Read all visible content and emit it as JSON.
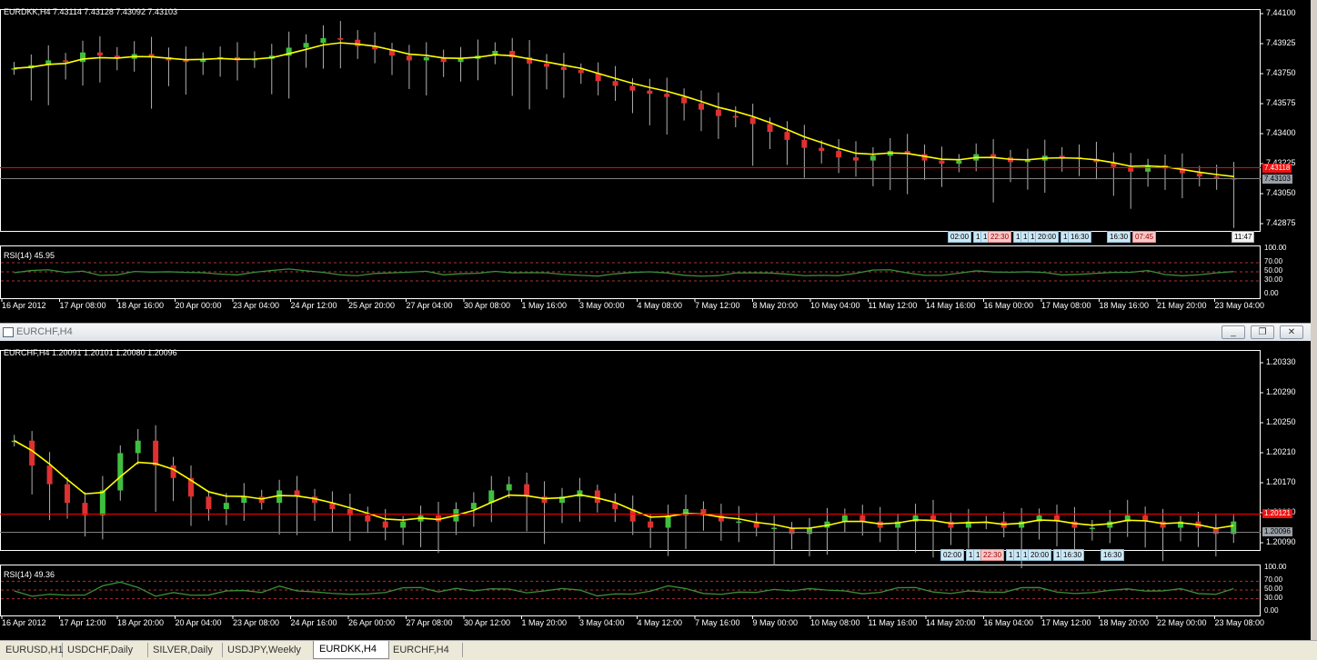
{
  "top_chart": {
    "info": "EURDKK,H4  7.43114 7.43128 7.43092 7.43103",
    "rsi_label": "RSI(14) 45.95",
    "price_ticks": [
      "7.44100",
      "7.43925",
      "7.43750",
      "7.43575",
      "7.43400",
      "7.43225",
      "7.43050",
      "7.42875"
    ],
    "rsi_ticks": [
      "100.00",
      "70.00",
      "50.00",
      "30.00",
      "0.00"
    ],
    "ask_badge": "7.43118",
    "bid_badge": "7.43103",
    "time_labels": [
      "16 Apr 2012",
      "17 Apr 08:00",
      "18 Apr 16:00",
      "20 Apr 00:00",
      "23 Apr 04:00",
      "24 Apr 12:00",
      "25 Apr 20:00",
      "27 Apr 04:00",
      "30 Apr 08:00",
      "1 May 16:00",
      "3 May 00:00",
      "4 May 08:00",
      "7 May 12:00",
      "8 May 20:00",
      "10 May 04:00",
      "11 May 12:00",
      "14 May 16:00",
      "16 May 00:00",
      "17 May 08:00",
      "18 May 16:00",
      "21 May 20:00",
      "23 May 04:00"
    ],
    "event_tags": [
      {
        "text": "02:00",
        "style": "blue"
      },
      {
        "text": "1",
        "style": "blue"
      },
      {
        "text": "1",
        "style": "blue"
      },
      {
        "text": "22:30",
        "style": "red"
      },
      {
        "text": "1",
        "style": "blue"
      },
      {
        "text": "1",
        "style": "blue"
      },
      {
        "text": "1",
        "style": "blue"
      },
      {
        "text": "20:00",
        "style": "blue"
      },
      {
        "text": "1",
        "style": "blue"
      },
      {
        "text": "16:30",
        "style": "blue"
      },
      {
        "text": "16:30",
        "style": "blue"
      },
      {
        "text": "07:45",
        "style": "red"
      },
      {
        "text": "11:47",
        "style": "white"
      }
    ]
  },
  "window": {
    "title": "EURCHF,H4",
    "minimize": "_",
    "restore": "❐",
    "close": "✕"
  },
  "bottom_chart": {
    "info": "EURCHF,H4  1.20091 1.20101 1.20080 1.20096",
    "rsi_label": "RSI(14) 49.36",
    "price_ticks": [
      "1.20330",
      "1.20290",
      "1.20250",
      "1.20210",
      "1.20170",
      "1.20130",
      "1.20090"
    ],
    "rsi_ticks": [
      "100.00",
      "70.00",
      "50.00",
      "30.00",
      "0.00"
    ],
    "ask_badge": "1.20121",
    "bid_badge": "1.20096",
    "time_labels": [
      "16 Apr 2012",
      "17 Apr 12:00",
      "18 Apr 20:00",
      "20 Apr 04:00",
      "23 Apr 08:00",
      "24 Apr 16:00",
      "26 Apr 00:00",
      "27 Apr 08:00",
      "30 Apr 12:00",
      "1 May 20:00",
      "3 May 04:00",
      "4 May 12:00",
      "7 May 16:00",
      "9 May 00:00",
      "10 May 08:00",
      "11 May 16:00",
      "14 May 20:00",
      "16 May 04:00",
      "17 May 12:00",
      "18 May 20:00",
      "22 May 00:00",
      "23 May 08:00"
    ],
    "event_tags": [
      {
        "text": "02:00",
        "style": "blue"
      },
      {
        "text": "1",
        "style": "blue"
      },
      {
        "text": "1",
        "style": "blue"
      },
      {
        "text": "22:30",
        "style": "red"
      },
      {
        "text": "1",
        "style": "blue"
      },
      {
        "text": "1",
        "style": "blue"
      },
      {
        "text": "1",
        "style": "blue"
      },
      {
        "text": "20:00",
        "style": "blue"
      },
      {
        "text": "1",
        "style": "blue"
      },
      {
        "text": "16:30",
        "style": "blue"
      },
      {
        "text": "16:30",
        "style": "blue"
      }
    ]
  },
  "tabs": [
    {
      "label": "EURUSD,H1",
      "active": false
    },
    {
      "label": "USDCHF,Daily",
      "active": false
    },
    {
      "label": "SILVER,Daily",
      "active": false
    },
    {
      "label": "USDJPY,Weekly",
      "active": false
    },
    {
      "label": "EURDKK,H4",
      "active": true
    },
    {
      "label": "EURCHF,H4",
      "active": false
    }
  ],
  "colors": {
    "background": "#000000",
    "bull": "#3fbf3f",
    "bear": "#e03030",
    "wick": "#b0b0b0",
    "ma": "#ffff00",
    "rsi": "#3a8f3a",
    "ask_line": "#ff0000",
    "bid_line": "#808080"
  },
  "chart_data": [
    {
      "type": "candlestick",
      "title": "EURDKK,H4",
      "ylim": [
        7.428,
        7.4415
      ],
      "closes": [
        7.438,
        7.4382,
        7.4385,
        7.4384,
        7.439,
        7.4388,
        7.4386,
        7.4389,
        7.4387,
        7.4385,
        7.4384,
        7.4386,
        7.4387,
        7.4385,
        7.4386,
        7.4388,
        7.4393,
        7.4396,
        7.4399,
        7.4398,
        7.4394,
        7.4392,
        7.4388,
        7.4385,
        7.4387,
        7.4384,
        7.4386,
        7.4388,
        7.4391,
        7.4387,
        7.4383,
        7.4381,
        7.4379,
        7.4377,
        7.4372,
        7.4369,
        7.4366,
        7.4364,
        7.4362,
        7.4358,
        7.4354,
        7.435,
        7.4349,
        7.4345,
        7.434,
        7.4335,
        7.433,
        7.4328,
        7.4324,
        7.4322,
        7.4325,
        7.4328,
        7.4326,
        7.4322,
        7.432,
        7.4322,
        7.4326,
        7.4324,
        7.4321,
        7.4322,
        7.4325,
        7.4324,
        7.4323,
        7.4321,
        7.4318,
        7.4315,
        7.4319,
        7.4317,
        7.4314,
        7.4312,
        7.4311,
        7.431
      ]
    },
    {
      "type": "candlestick",
      "title": "EURCHF,H4",
      "ylim": [
        1.2005,
        1.2036
      ],
      "closes": [
        1.2022,
        1.2018,
        1.2015,
        1.2012,
        1.201,
        1.2014,
        1.202,
        1.2022,
        1.2018,
        1.2016,
        1.2013,
        1.2011,
        1.2012,
        1.2013,
        1.2012,
        1.2014,
        1.2013,
        1.2012,
        1.2011,
        1.201,
        1.2009,
        1.2008,
        1.2009,
        1.201,
        1.2009,
        1.2011,
        1.2012,
        1.2014,
        1.2015,
        1.2013,
        1.2012,
        1.2013,
        1.2014,
        1.2012,
        1.2011,
        1.2009,
        1.2008,
        1.201,
        1.2011,
        1.201,
        1.2009,
        1.2009,
        1.2008,
        1.2008,
        1.2007,
        1.2008,
        1.2009,
        1.201,
        1.2009,
        1.2008,
        1.2009,
        1.201,
        1.2009,
        1.2008,
        1.2009,
        1.2009,
        1.2008,
        1.2009,
        1.201,
        1.2009,
        1.2008,
        1.2008,
        1.2009,
        1.201,
        1.2009,
        1.2008,
        1.2009,
        1.2008,
        1.2007,
        1.2009
      ]
    }
  ]
}
